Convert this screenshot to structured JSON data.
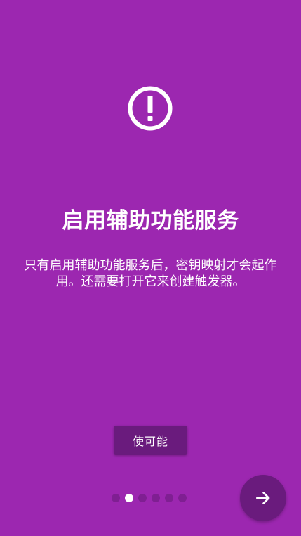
{
  "intro": {
    "icon": "alert-circle-icon",
    "title": "启用辅助功能服务",
    "description": "只有启用辅助功能服务后，密钥映射才会起作用。还需要打开它来创建触发器。",
    "enable_button_label": "使可能",
    "next_icon": "arrow-right-icon"
  },
  "pager": {
    "total_pages": 6,
    "current_page": 2
  },
  "colors": {
    "background": "#9c27b0",
    "button": "#6a1b7d",
    "dot_inactive": "#7f1f92",
    "dot_active": "#ffffff",
    "text": "#ffffff"
  }
}
